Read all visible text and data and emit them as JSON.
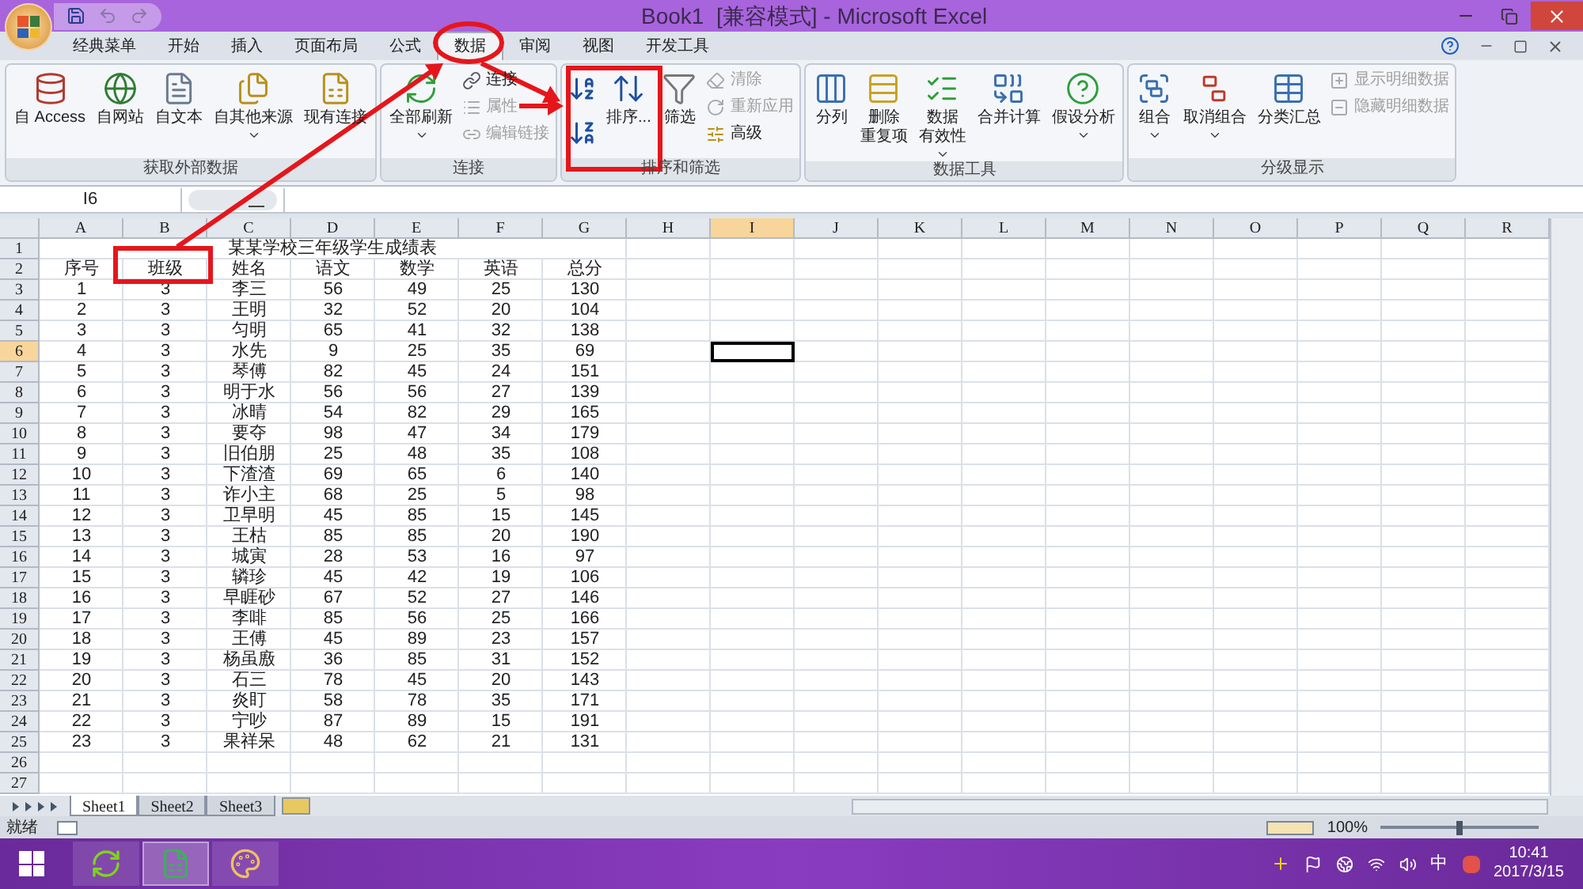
{
  "window": {
    "title": "Book1  [兼容模式] - Microsoft Excel"
  },
  "tabs": [
    {
      "label": "经典菜单",
      "selected": false
    },
    {
      "label": "开始",
      "selected": false
    },
    {
      "label": "插入",
      "selected": false
    },
    {
      "label": "页面布局",
      "selected": false
    },
    {
      "label": "公式",
      "selected": false
    },
    {
      "label": "数据",
      "selected": true
    },
    {
      "label": "审阅",
      "selected": false
    },
    {
      "label": "视图",
      "selected": false
    },
    {
      "label": "开发工具",
      "selected": false
    }
  ],
  "ribbon": [
    {
      "title": "获取外部数据",
      "columns": [
        [
          {
            "kind": "large",
            "label": "自 Access",
            "disabled": false,
            "dropdown": false
          }
        ],
        [
          {
            "kind": "large",
            "label": "自网站",
            "disabled": false,
            "dropdown": false
          }
        ],
        [
          {
            "kind": "large",
            "label": "自文本",
            "disabled": false,
            "dropdown": false
          }
        ],
        [
          {
            "kind": "large",
            "label": "自其他来源",
            "disabled": false,
            "dropdown": true
          }
        ],
        [
          {
            "kind": "large",
            "label": "现有连接",
            "disabled": false,
            "dropdown": false
          }
        ]
      ]
    },
    {
      "title": "连接",
      "columns": [
        [
          {
            "kind": "large",
            "label": "全部刷新",
            "disabled": false,
            "dropdown": true
          }
        ],
        [
          {
            "kind": "small",
            "label": "连接",
            "disabled": false
          },
          {
            "kind": "small",
            "label": "属性",
            "disabled": true
          },
          {
            "kind": "small",
            "label": "编辑链接",
            "disabled": true
          }
        ]
      ]
    },
    {
      "title": "排序和筛选",
      "columns": [
        [
          {
            "kind": "icon",
            "disabled": false
          },
          {
            "kind": "icon",
            "disabled": false
          }
        ],
        [
          {
            "kind": "large",
            "label": "排序...",
            "disabled": false,
            "dropdown": false
          }
        ],
        [
          {
            "kind": "large",
            "label": "筛选",
            "disabled": false,
            "dropdown": false
          }
        ],
        [
          {
            "kind": "small",
            "label": "清除",
            "disabled": true
          },
          {
            "kind": "small",
            "label": "重新应用",
            "disabled": true
          },
          {
            "kind": "small",
            "label": "高级",
            "disabled": false
          }
        ]
      ]
    },
    {
      "title": "数据工具",
      "columns": [
        [
          {
            "kind": "large",
            "label": "分列",
            "disabled": false,
            "dropdown": false
          }
        ],
        [
          {
            "kind": "large",
            "label": [
              "删除",
              "重复项"
            ],
            "disabled": false,
            "dropdown": false
          }
        ],
        [
          {
            "kind": "large",
            "label": [
              "数据",
              "有效性"
            ],
            "disabled": false,
            "dropdown": true
          }
        ],
        [
          {
            "kind": "large",
            "label": "合并计算",
            "disabled": false,
            "dropdown": false
          }
        ],
        [
          {
            "kind": "large",
            "label": "假设分析",
            "disabled": false,
            "dropdown": true
          }
        ]
      ]
    },
    {
      "title": "分级显示",
      "columns": [
        [
          {
            "kind": "large",
            "label": "组合",
            "disabled": false,
            "dropdown": true
          }
        ],
        [
          {
            "kind": "large",
            "label": "取消组合",
            "disabled": false,
            "dropdown": true
          }
        ],
        [
          {
            "kind": "large",
            "label": "分类汇总",
            "disabled": false,
            "dropdown": false
          }
        ],
        [
          {
            "kind": "small",
            "label": "显示明细数据",
            "disabled": true
          },
          {
            "kind": "small",
            "label": "隐藏明细数据",
            "disabled": true
          }
        ]
      ]
    }
  ],
  "formula_bar": {
    "name_box": "I6"
  },
  "sheet": {
    "columns": [
      {
        "label": "A",
        "selected": false
      },
      {
        "label": "B",
        "selected": false
      },
      {
        "label": "C",
        "selected": false
      },
      {
        "label": "D",
        "selected": false
      },
      {
        "label": "E",
        "selected": false
      },
      {
        "label": "F",
        "selected": false
      },
      {
        "label": "G",
        "selected": false
      },
      {
        "label": "H",
        "selected": false
      },
      {
        "label": "I",
        "selected": true
      },
      {
        "label": "J",
        "selected": false
      },
      {
        "label": "K",
        "selected": false
      },
      {
        "label": "L",
        "selected": false
      },
      {
        "label": "M",
        "selected": false
      },
      {
        "label": "N",
        "selected": false
      },
      {
        "label": "O",
        "selected": false
      },
      {
        "label": "P",
        "selected": false
      },
      {
        "label": "Q",
        "selected": false
      },
      {
        "label": "R",
        "selected": false
      }
    ],
    "rows": [
      {
        "number": "1",
        "selected": false,
        "kind": "title",
        "cells": [
          "某某学校三年级学生成绩表"
        ]
      },
      {
        "number": "2",
        "selected": false,
        "kind": "data",
        "cells": [
          "序号",
          "班级",
          "姓名",
          "语文",
          "数学",
          "英语",
          "总分"
        ]
      },
      {
        "number": "3",
        "selected": false,
        "kind": "data",
        "cells": [
          "1",
          "3",
          "李三",
          "56",
          "49",
          "25",
          "130"
        ]
      },
      {
        "number": "4",
        "selected": false,
        "kind": "data",
        "cells": [
          "2",
          "3",
          "王明",
          "32",
          "52",
          "20",
          "104"
        ]
      },
      {
        "number": "5",
        "selected": false,
        "kind": "data",
        "cells": [
          "3",
          "3",
          "匀明",
          "65",
          "41",
          "32",
          "138"
        ]
      },
      {
        "number": "6",
        "selected": true,
        "kind": "data",
        "cells": [
          "4",
          "3",
          "水先",
          "9",
          "25",
          "35",
          "69"
        ]
      },
      {
        "number": "7",
        "selected": false,
        "kind": "data",
        "cells": [
          "5",
          "3",
          "琴傅",
          "82",
          "45",
          "24",
          "151"
        ]
      },
      {
        "number": "8",
        "selected": false,
        "kind": "data",
        "cells": [
          "6",
          "3",
          "明于水",
          "56",
          "56",
          "27",
          "139"
        ]
      },
      {
        "number": "9",
        "selected": false,
        "kind": "data",
        "cells": [
          "7",
          "3",
          "冰晴",
          "54",
          "82",
          "29",
          "165"
        ]
      },
      {
        "number": "10",
        "selected": false,
        "kind": "data",
        "cells": [
          "8",
          "3",
          "要夺",
          "98",
          "47",
          "34",
          "179"
        ]
      },
      {
        "number": "11",
        "selected": false,
        "kind": "data",
        "cells": [
          "9",
          "3",
          "旧伯朋",
          "25",
          "48",
          "35",
          "108"
        ]
      },
      {
        "number": "12",
        "selected": false,
        "kind": "data",
        "cells": [
          "10",
          "3",
          "下渣渣",
          "69",
          "65",
          "6",
          "140"
        ]
      },
      {
        "number": "13",
        "selected": false,
        "kind": "data",
        "cells": [
          "11",
          "3",
          "诈小主",
          "68",
          "25",
          "5",
          "98"
        ]
      },
      {
        "number": "14",
        "selected": false,
        "kind": "data",
        "cells": [
          "12",
          "3",
          "卫早明",
          "45",
          "85",
          "15",
          "145"
        ]
      },
      {
        "number": "15",
        "selected": false,
        "kind": "data",
        "cells": [
          "13",
          "3",
          "王枯",
          "85",
          "85",
          "20",
          "190"
        ]
      },
      {
        "number": "16",
        "selected": false,
        "kind": "data",
        "cells": [
          "14",
          "3",
          "城寅",
          "28",
          "53",
          "16",
          "97"
        ]
      },
      {
        "number": "17",
        "selected": false,
        "kind": "data",
        "cells": [
          "15",
          "3",
          "辚珍",
          "45",
          "42",
          "19",
          "106"
        ]
      },
      {
        "number": "18",
        "selected": false,
        "kind": "data",
        "cells": [
          "16",
          "3",
          "早睚砂",
          "67",
          "52",
          "27",
          "146"
        ]
      },
      {
        "number": "19",
        "selected": false,
        "kind": "data",
        "cells": [
          "17",
          "3",
          "李啡",
          "85",
          "56",
          "25",
          "166"
        ]
      },
      {
        "number": "20",
        "selected": false,
        "kind": "data",
        "cells": [
          "18",
          "3",
          "王傅",
          "45",
          "89",
          "23",
          "157"
        ]
      },
      {
        "number": "21",
        "selected": false,
        "kind": "data",
        "cells": [
          "19",
          "3",
          "杨虽廒",
          "36",
          "85",
          "31",
          "152"
        ]
      },
      {
        "number": "22",
        "selected": false,
        "kind": "data",
        "cells": [
          "20",
          "3",
          "石三",
          "78",
          "45",
          "20",
          "143"
        ]
      },
      {
        "number": "23",
        "selected": false,
        "kind": "data",
        "cells": [
          "21",
          "3",
          "炎盯",
          "58",
          "78",
          "35",
          "171"
        ]
      },
      {
        "number": "24",
        "selected": false,
        "kind": "data",
        "cells": [
          "22",
          "3",
          "宁吵",
          "87",
          "89",
          "15",
          "191"
        ]
      },
      {
        "number": "25",
        "selected": false,
        "kind": "data",
        "cells": [
          "23",
          "3",
          "果祥呆",
          "48",
          "62",
          "21",
          "131"
        ]
      },
      {
        "number": "26",
        "selected": false,
        "kind": "data"
      },
      {
        "number": "27",
        "selected": false,
        "kind": "data"
      }
    ]
  },
  "sheet_tabs": [
    {
      "label": "Sheet1",
      "selected": true
    },
    {
      "label": "Sheet2",
      "selected": false
    },
    {
      "label": "Sheet3",
      "selected": false
    }
  ],
  "status_bar": {
    "text": "就绪",
    "zoom": "100%",
    "zoom_slider": {
      "level": 0.5
    }
  },
  "taskbar": {
    "input_method": "中",
    "time": "10:41",
    "date": "2017/3/15"
  }
}
